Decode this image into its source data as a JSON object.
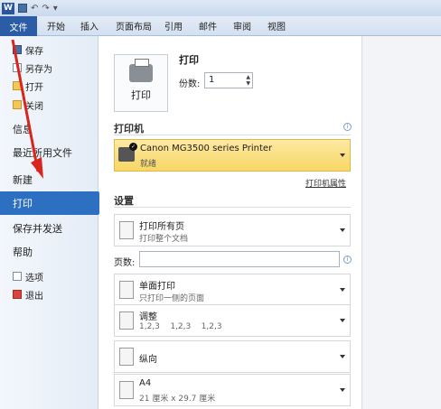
{
  "titlebar": {
    "app_letter": "W",
    "undo": "↶",
    "redo": "↷",
    "customize": "▾"
  },
  "ribbon": {
    "tabs": [
      "文件",
      "开始",
      "插入",
      "页面布局",
      "引用",
      "邮件",
      "审阅",
      "视图"
    ]
  },
  "sidebar": {
    "save": "保存",
    "save_as": "另存为",
    "open": "打开",
    "close": "关闭",
    "info": "信息",
    "recent": "最近所用文件",
    "new": "新建",
    "print": "打印",
    "save_send": "保存并发送",
    "help": "帮助",
    "options": "选项",
    "exit": "退出"
  },
  "print": {
    "heading": "打印",
    "button_label": "打印",
    "copies_label": "份数:",
    "copies_value": "1"
  },
  "printer": {
    "section_title": "打印机",
    "name": "Canon MG3500 series Printer",
    "status": "就绪",
    "properties_link": "打印机属性"
  },
  "settings": {
    "section_title": "设置",
    "pages_label": "页数:",
    "pages_value": "",
    "options": [
      {
        "main": "打印所有页",
        "sub": "打印整个文档"
      },
      {
        "main": "单面打印",
        "sub": "只打印一侧的页面"
      },
      {
        "main": "调整",
        "sub": "1,2,3    1,2,3    1,2,3"
      },
      {
        "main": "纵向",
        "sub": ""
      },
      {
        "main": "A4",
        "sub": "21 厘米 x 29.7 厘米"
      }
    ]
  },
  "annotation": {
    "arrow_color": "#d9261c"
  },
  "colors": {
    "accent": "#2d6fc1",
    "printer_highlight": "#f7d766"
  }
}
